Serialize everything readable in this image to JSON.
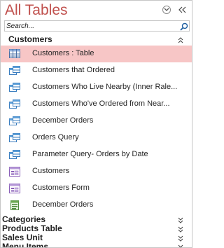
{
  "pane": {
    "title": "All Tables"
  },
  "search": {
    "placeholder": "Search..."
  },
  "groups": {
    "customers": {
      "label": "Customers",
      "items": [
        {
          "label": "Customers : Table",
          "icon": "table-icon"
        },
        {
          "label": "Customers that Ordered",
          "icon": "query-icon"
        },
        {
          "label": "Customers Who Live Nearby (Inner Rale...",
          "icon": "query-icon"
        },
        {
          "label": "Customers Who've Ordered from Near...",
          "icon": "query-icon"
        },
        {
          "label": "December Orders",
          "icon": "query-icon"
        },
        {
          "label": "Orders Query",
          "icon": "query-icon"
        },
        {
          "label": "Parameter Query- Orders by Date",
          "icon": "query-icon"
        },
        {
          "label": "Customers",
          "icon": "form-icon"
        },
        {
          "label": "Customers Form",
          "icon": "form-icon"
        },
        {
          "label": "December Orders",
          "icon": "report-icon"
        }
      ]
    },
    "categories": {
      "label": "Categories"
    },
    "products_table": {
      "label": "Products Table"
    },
    "sales_unit": {
      "label": "Sales Unit"
    },
    "menu_items": {
      "label": "Menu Items"
    }
  },
  "colors": {
    "title": "#c0504d",
    "selected": "#f7c6c6"
  }
}
